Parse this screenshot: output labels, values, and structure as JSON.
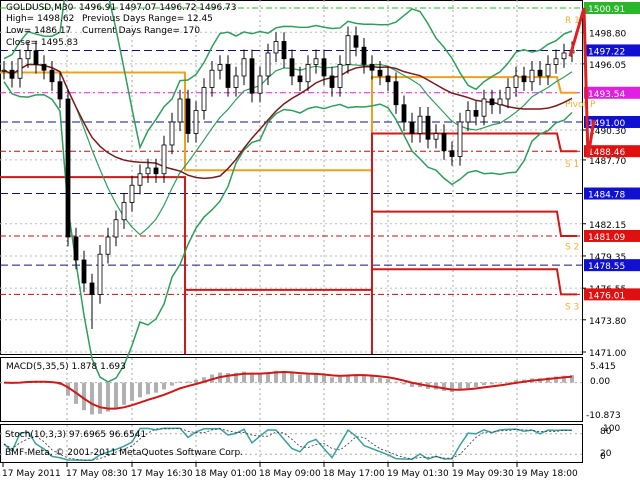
{
  "header": {
    "symbol": "GOLDUSD,M30",
    "ohlc": "1496.91 1497.07 1496.72 1496.73",
    "high": "High= 1498.62",
    "low": "Low= 1486.17",
    "close": "Close= 1495.83",
    "prev_range": "Previous Days Range= 12.45",
    "cur_range": "Current Days Range= 170"
  },
  "macd": {
    "label": "MACD(5,35,5) 1.878 1.693",
    "ticks": [
      "5.415",
      "0.00",
      "-10.873"
    ],
    "range": [
      -10.873,
      5.415
    ]
  },
  "stoch": {
    "label": "Stoch(10,3,3) 97.6965 96.6541",
    "ticks": [
      "100",
      "80",
      "20",
      "0"
    ]
  },
  "copyright": "BMF-Meta, © 2001-2011 MetaQuotes Software Corp.",
  "colors": {
    "up": "#000000",
    "bb": "#2e9e5b",
    "ma": "#7a1a1a",
    "pivot": "#f0a020",
    "support": "#d01818",
    "macd_line": "#d01818",
    "hist": "#b0b0b0",
    "stoch": "#3aa0a0"
  },
  "chart_data": {
    "type": "candlestick",
    "ylim": [
      1471.0,
      1500.91
    ],
    "price_ticks": [
      "1498.80",
      "1496.05",
      "1490.30",
      "1487.70",
      "1482.15",
      "1479.35",
      "1476.55",
      "1473.80",
      "1471.00"
    ],
    "level_boxes": [
      {
        "value": "1500.91",
        "color": "#2bb52b",
        "style": "green"
      },
      {
        "value": "1497.22",
        "color": "#1010d0",
        "style": "navy"
      },
      {
        "value": "1493.54",
        "color": "#e020e0",
        "style": "magenta"
      },
      {
        "value": "1491.00",
        "color": "#1010d0",
        "style": "navy"
      },
      {
        "value": "1488.46",
        "color": "#e01010",
        "style": "red"
      },
      {
        "value": "1484.78",
        "color": "#1010d0",
        "style": "navy"
      },
      {
        "value": "1481.09",
        "color": "#e01010",
        "style": "red"
      },
      {
        "value": "1478.55",
        "color": "#1010d0",
        "style": "navy"
      },
      {
        "value": "1476.01",
        "color": "#e01010",
        "style": "red"
      }
    ],
    "pivot_labels": [
      {
        "text": "R 1",
        "price": 1500.3
      },
      {
        "text": "Pivot P",
        "price": 1493.0
      },
      {
        "text": "S 1",
        "price": 1487.8
      },
      {
        "text": "S 2",
        "price": 1480.6
      },
      {
        "text": "S 3",
        "price": 1475.4
      }
    ],
    "time_labels": [
      "17 May 2011",
      "17 May 08:30",
      "17 May 16:30",
      "18 May 01:00",
      "18 May 09:00",
      "18 May 17:00",
      "19 May 01:30",
      "19 May 09:30",
      "19 May 18:00"
    ],
    "closes": [
      1495.5,
      1494.8,
      1496.5,
      1497.2,
      1496,
      1495.5,
      1494.5,
      1493,
      1481,
      1479,
      1477,
      1476,
      1479.5,
      1481,
      1482.5,
      1484,
      1485.5,
      1486.5,
      1487,
      1486.5,
      1489,
      1491,
      1493,
      1490,
      1492,
      1494,
      1495.5,
      1496,
      1494,
      1495,
      1496.5,
      1493.5,
      1495,
      1497,
      1498,
      1496.5,
      1495,
      1494.5,
      1496,
      1496.5,
      1495,
      1494,
      1496,
      1498.5,
      1497.5,
      1496,
      1495.5,
      1495,
      1494.5,
      1492.5,
      1491,
      1490,
      1491.5,
      1489.5,
      1490,
      1488.5,
      1488,
      1491,
      1492,
      1491.5,
      1493,
      1492.5,
      1493,
      1494,
      1495,
      1494.5,
      1495.5,
      1495,
      1496,
      1496.5,
      1497,
      1497.2
    ],
    "pivot_segments": [
      {
        "series": "pivot",
        "levels": [
          1495.3,
          1486.8,
          1494.9,
          1493.54
        ]
      },
      {
        "series": "s1",
        "levels": [
          1486.2,
          1476.4,
          1490.0,
          1488.46
        ]
      },
      {
        "series": "s2",
        "levels": [
          null,
          null,
          1483.2,
          1481.09
        ]
      },
      {
        "series": "s3",
        "levels": [
          null,
          null,
          1478.2,
          1476.01
        ]
      }
    ]
  }
}
